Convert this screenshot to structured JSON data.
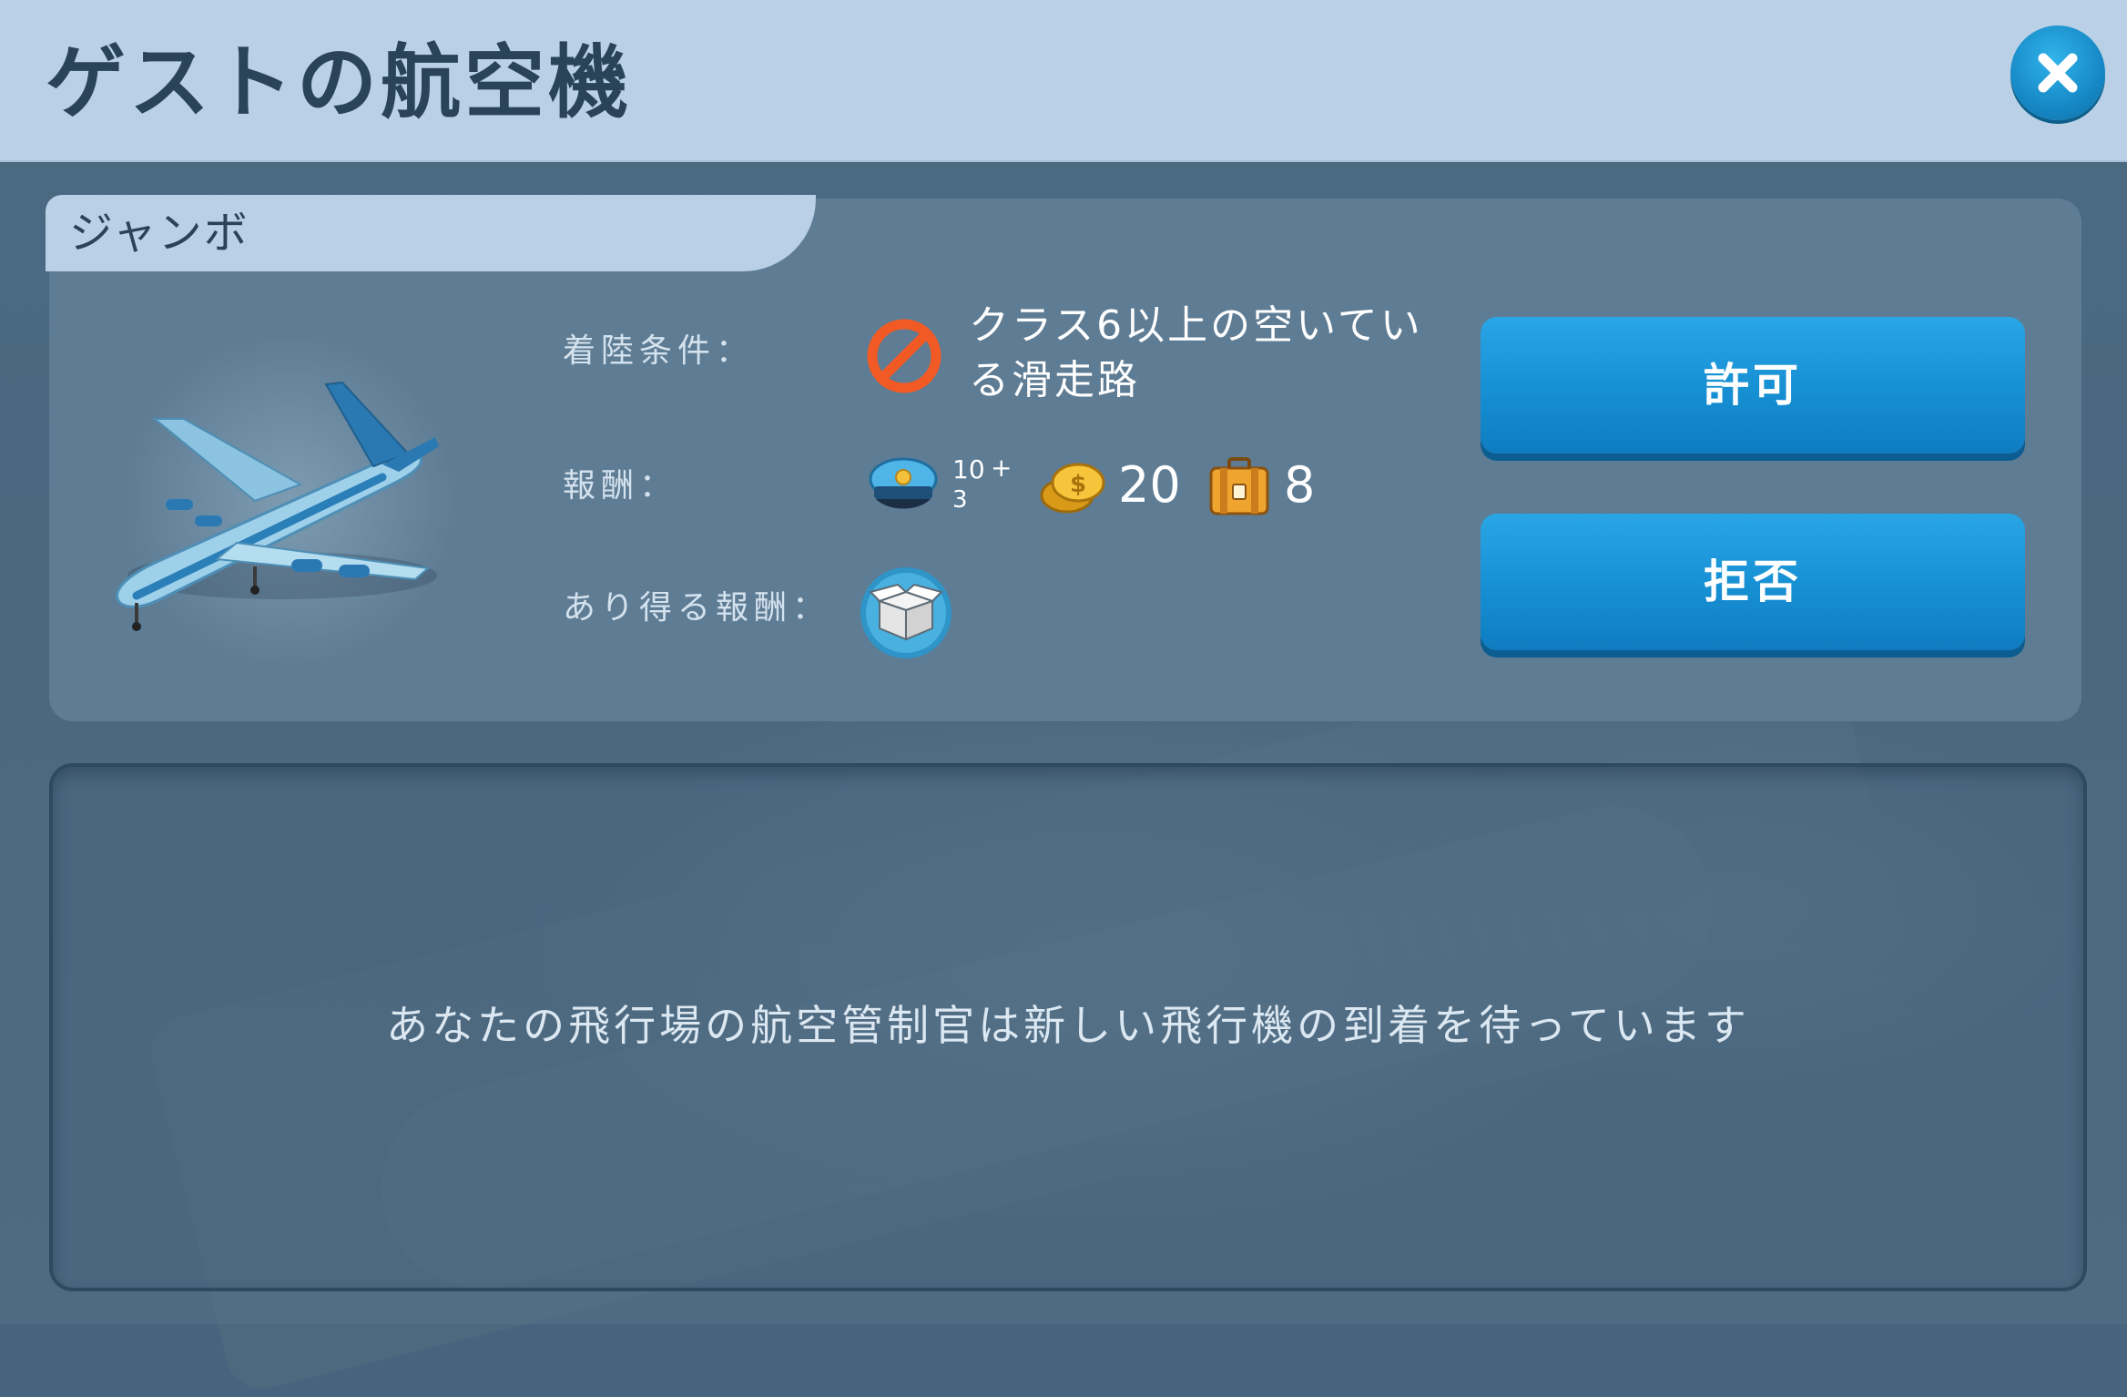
{
  "header": {
    "title": "ゲストの航空機",
    "close_icon": "close-icon"
  },
  "aircraft": {
    "name": "ジャンボ",
    "image_icon": "jumbo-jet-icon"
  },
  "details": {
    "landing_label": "着陸条件：",
    "landing_condition": "クラス6以上の空いている滑走路",
    "landing_condition_icon": "prohibited-icon",
    "reward_label": "報酬：",
    "rewards": {
      "pilot_xp": "10",
      "pilot_plus": "+",
      "pilot_sub": "3",
      "coins": "20",
      "cargo": "8"
    },
    "possible_reward_label": "あり得る報酬：",
    "possible_reward_icon": "crate-icon"
  },
  "actions": {
    "allow_label": "許可",
    "deny_label": "拒否"
  },
  "message": {
    "text": "あなたの飛行場の航空管制官は新しい飛行機の到着を待っています"
  },
  "colors": {
    "header_bg": "#b9d0e6",
    "button": "#178fd3",
    "prohibited": "#f15a24"
  }
}
